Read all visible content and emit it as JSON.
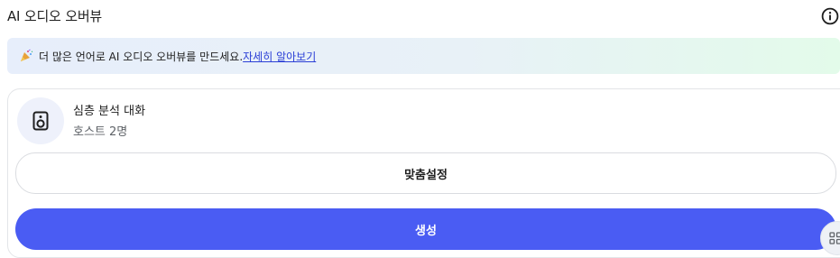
{
  "header": {
    "title": "AI 오디오 오버뷰",
    "info_icon": "info-icon"
  },
  "banner": {
    "icon": "party-popper-icon",
    "message": "더 많은 언어로 AI 오디오 오버뷰를 만드세요.",
    "link_label": "자세히 알아보기"
  },
  "format": {
    "icon": "speaker-icon",
    "title": "심층 분석 대화",
    "subtitle": "호스트 2명"
  },
  "actions": {
    "customize_label": "맞춤설정",
    "generate_label": "생성"
  },
  "colors": {
    "accent": "#4a5cf3",
    "link": "#2b3fd6",
    "icon_bg": "#eef1fb"
  },
  "floating_button": {
    "icon": "grid-icon"
  }
}
